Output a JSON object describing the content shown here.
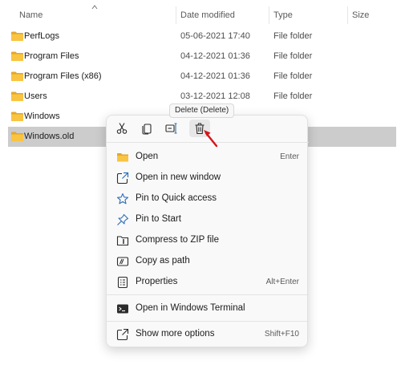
{
  "header": {
    "columns": [
      {
        "label": "Name"
      },
      {
        "label": "Date modified"
      },
      {
        "label": "Type"
      },
      {
        "label": "Size"
      }
    ]
  },
  "files": [
    {
      "name": "PerfLogs",
      "date": "05-06-2021 17:40",
      "type": "File folder"
    },
    {
      "name": "Program Files",
      "date": "04-12-2021 01:36",
      "type": "File folder"
    },
    {
      "name": "Program Files (x86)",
      "date": "04-12-2021 01:36",
      "type": "File folder"
    },
    {
      "name": "Users",
      "date": "03-12-2021 12:08",
      "type": "File folder"
    },
    {
      "name": "Windows",
      "date": "",
      "type": ""
    },
    {
      "name": "Windows.old",
      "date": "",
      "type": ""
    }
  ],
  "tooltip": {
    "text": "Delete (Delete)"
  },
  "context_menu": {
    "quick_actions": [
      {
        "name": "cut",
        "icon": "scissors-icon"
      },
      {
        "name": "copy",
        "icon": "copy-icon"
      },
      {
        "name": "rename",
        "icon": "rename-icon"
      },
      {
        "name": "delete",
        "icon": "trash-icon"
      }
    ],
    "items": [
      {
        "label": "Open",
        "shortcut": "Enter",
        "icon": "folder-icon"
      },
      {
        "label": "Open in new window",
        "shortcut": "",
        "icon": "open-new-window-icon"
      },
      {
        "label": "Pin to Quick access",
        "shortcut": "",
        "icon": "star-icon"
      },
      {
        "label": "Pin to Start",
        "shortcut": "",
        "icon": "pin-icon"
      },
      {
        "label": "Compress to ZIP file",
        "shortcut": "",
        "icon": "zip-icon"
      },
      {
        "label": "Copy as path",
        "shortcut": "",
        "icon": "copy-path-icon"
      },
      {
        "label": "Properties",
        "shortcut": "Alt+Enter",
        "icon": "properties-icon"
      },
      {
        "label": "Open in Windows Terminal",
        "shortcut": "",
        "icon": "terminal-icon"
      },
      {
        "label": "Show more options",
        "shortcut": "Shift+F10",
        "icon": "more-options-icon"
      }
    ]
  },
  "colors": {
    "folder": "#f8c442",
    "folder_dark": "#e3a82b",
    "selection": "#cccccc",
    "menu_bg": "#f9f9f9",
    "accent_arrow": "#d8131b",
    "icon_blue": "#2f6fb8"
  }
}
